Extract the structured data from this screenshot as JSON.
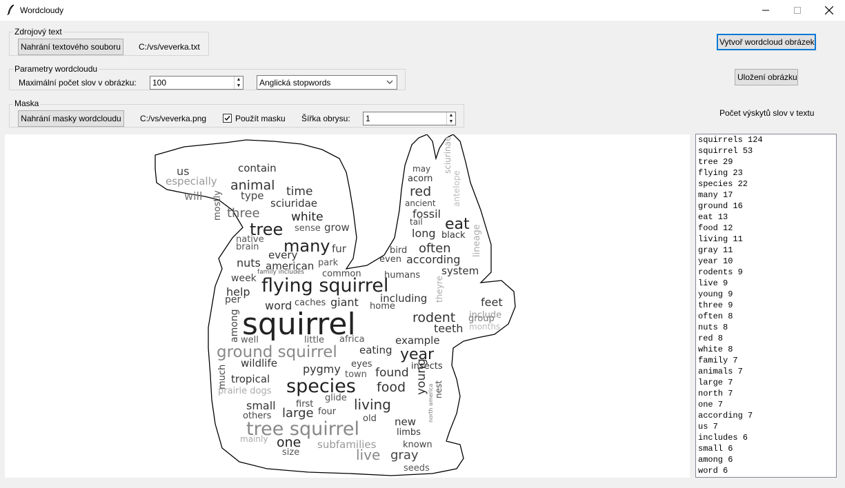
{
  "window": {
    "title": "Wordcloudy",
    "minimize_glyph": "—",
    "maximize_glyph": "☐",
    "close_glyph": "✕"
  },
  "source": {
    "legend": "Zdrojový text",
    "load_button": "Nahrání textového souboru",
    "file_path": "C:/vs/veverka.txt"
  },
  "params": {
    "legend": "Parametry wordcloudu",
    "max_words_label": "Maximální počet slov v obrázku:",
    "max_words_value": "100",
    "stopwords_selected": "Anglická stopwords"
  },
  "mask": {
    "legend": "Maska",
    "load_button": "Nahrání masky wordcloudu",
    "file_path": "C:/vs/veverka.png",
    "use_mask_label": "Použít masku",
    "use_mask_checked": true,
    "outline_label": "Šířka obrysu:",
    "outline_value": "1"
  },
  "actions": {
    "create_button": "Vytvoř wordcloud obrázek",
    "save_button": "Uložení obrázku",
    "counts_label": "Počet výskytů slov v textu"
  },
  "word_counts": [
    "squirrels 124",
    "squirrel 53",
    "tree 29",
    "flying 23",
    "species 22",
    "many 17",
    "ground 16",
    "eat 13",
    "food 12",
    "living 11",
    "gray 11",
    "year 10",
    "rodents 9",
    "live 9",
    "young 9",
    "three 9",
    "often 8",
    "nuts 8",
    "red 8",
    "white 8",
    "family 7",
    "animals 7",
    "large 7",
    "north 7",
    "one 7",
    "according 7",
    "us 7",
    "includes 6",
    "small 6",
    "among 6",
    "word 6"
  ],
  "cloud_words": [
    {
      "t": "us",
      "c": "#444"
    },
    {
      "t": "contain",
      "c": "#333"
    },
    {
      "t": "especially",
      "c": "#999"
    },
    {
      "t": "animal",
      "c": "#333"
    },
    {
      "t": "time",
      "c": "#333"
    },
    {
      "t": "will",
      "c": "#777"
    },
    {
      "t": "type",
      "c": "#444"
    },
    {
      "t": "sciuridae",
      "c": "#333"
    },
    {
      "t": "three",
      "c": "#666"
    },
    {
      "t": "white",
      "c": "#222"
    },
    {
      "t": "mostly",
      "c": "#555"
    },
    {
      "t": "tree",
      "c": "#222"
    },
    {
      "t": "sense",
      "c": "#555"
    },
    {
      "t": "grow",
      "c": "#444"
    },
    {
      "t": "native",
      "c": "#555"
    },
    {
      "t": "brain",
      "c": "#555"
    },
    {
      "t": "many",
      "c": "#222"
    },
    {
      "t": "fur",
      "c": "#444"
    },
    {
      "t": "every",
      "c": "#333"
    },
    {
      "t": "nuts",
      "c": "#333"
    },
    {
      "t": "american",
      "c": "#333"
    },
    {
      "t": "park",
      "c": "#555"
    },
    {
      "t": "family includes",
      "c": "#555"
    },
    {
      "t": "common",
      "c": "#444"
    },
    {
      "t": "week",
      "c": "#444"
    },
    {
      "t": "flying squirrel",
      "c": "#222"
    },
    {
      "t": "help",
      "c": "#333"
    },
    {
      "t": "per",
      "c": "#444"
    },
    {
      "t": "word",
      "c": "#333"
    },
    {
      "t": "caches",
      "c": "#444"
    },
    {
      "t": "giant",
      "c": "#333"
    },
    {
      "t": "home",
      "c": "#444"
    },
    {
      "t": "among",
      "c": "#444"
    },
    {
      "t": "squirrel",
      "c": "#222"
    },
    {
      "t": "well",
      "c": "#555"
    },
    {
      "t": "little",
      "c": "#555"
    },
    {
      "t": "africa",
      "c": "#555"
    },
    {
      "t": "ground squirrel",
      "c": "#888"
    },
    {
      "t": "eating",
      "c": "#333"
    },
    {
      "t": "wildlife",
      "c": "#333"
    },
    {
      "t": "eyes",
      "c": "#444"
    },
    {
      "t": "much",
      "c": "#444"
    },
    {
      "t": "town",
      "c": "#555"
    },
    {
      "t": "pygmy",
      "c": "#333"
    },
    {
      "t": "found",
      "c": "#333"
    },
    {
      "t": "tropical",
      "c": "#333"
    },
    {
      "t": "species",
      "c": "#222"
    },
    {
      "t": "food",
      "c": "#333"
    },
    {
      "t": "prairie dogs",
      "c": "#aaa"
    },
    {
      "t": "glide",
      "c": "#555"
    },
    {
      "t": "first",
      "c": "#444"
    },
    {
      "t": "small",
      "c": "#333"
    },
    {
      "t": "living",
      "c": "#333"
    },
    {
      "t": "others",
      "c": "#444"
    },
    {
      "t": "large",
      "c": "#333"
    },
    {
      "t": "four",
      "c": "#444"
    },
    {
      "t": "old",
      "c": "#444"
    },
    {
      "t": "tree squirrel",
      "c": "#888"
    },
    {
      "t": "new",
      "c": "#333"
    },
    {
      "t": "limbs",
      "c": "#333"
    },
    {
      "t": "mainly",
      "c": "#aaa"
    },
    {
      "t": "one",
      "c": "#222"
    },
    {
      "t": "subfamilies",
      "c": "#999"
    },
    {
      "t": "known",
      "c": "#444"
    },
    {
      "t": "size",
      "c": "#555"
    },
    {
      "t": "live",
      "c": "#888"
    },
    {
      "t": "gray",
      "c": "#444"
    },
    {
      "t": "seeds",
      "c": "#555"
    },
    {
      "t": "may",
      "c": "#444"
    },
    {
      "t": "acorn",
      "c": "#333"
    },
    {
      "t": "sciurinae",
      "c": "#aaa"
    },
    {
      "t": "red",
      "c": "#333"
    },
    {
      "t": "antelope",
      "c": "#bbb"
    },
    {
      "t": "ancient",
      "c": "#444"
    },
    {
      "t": "fossil",
      "c": "#333"
    },
    {
      "t": "tail",
      "c": "#444"
    },
    {
      "t": "eat",
      "c": "#222"
    },
    {
      "t": "long",
      "c": "#333"
    },
    {
      "t": "black",
      "c": "#333"
    },
    {
      "t": "lineage",
      "c": "#aaa"
    },
    {
      "t": "bird",
      "c": "#444"
    },
    {
      "t": "often",
      "c": "#333"
    },
    {
      "t": "even",
      "c": "#444"
    },
    {
      "t": "according",
      "c": "#333"
    },
    {
      "t": "system",
      "c": "#333"
    },
    {
      "t": "humans",
      "c": "#444"
    },
    {
      "t": "theyre",
      "c": "#aaa"
    },
    {
      "t": "including",
      "c": "#333"
    },
    {
      "t": "feet",
      "c": "#333"
    },
    {
      "t": "include",
      "c": "#999"
    },
    {
      "t": "rodent",
      "c": "#333"
    },
    {
      "t": "group",
      "c": "#777"
    },
    {
      "t": "months",
      "c": "#bbb"
    },
    {
      "t": "teeth",
      "c": "#333"
    },
    {
      "t": "example",
      "c": "#333"
    },
    {
      "t": "year",
      "c": "#222"
    },
    {
      "t": "insects",
      "c": "#333"
    },
    {
      "t": "young",
      "c": "#333"
    },
    {
      "t": "nest",
      "c": "#444"
    },
    {
      "t": "north america",
      "c": "#777"
    }
  ]
}
